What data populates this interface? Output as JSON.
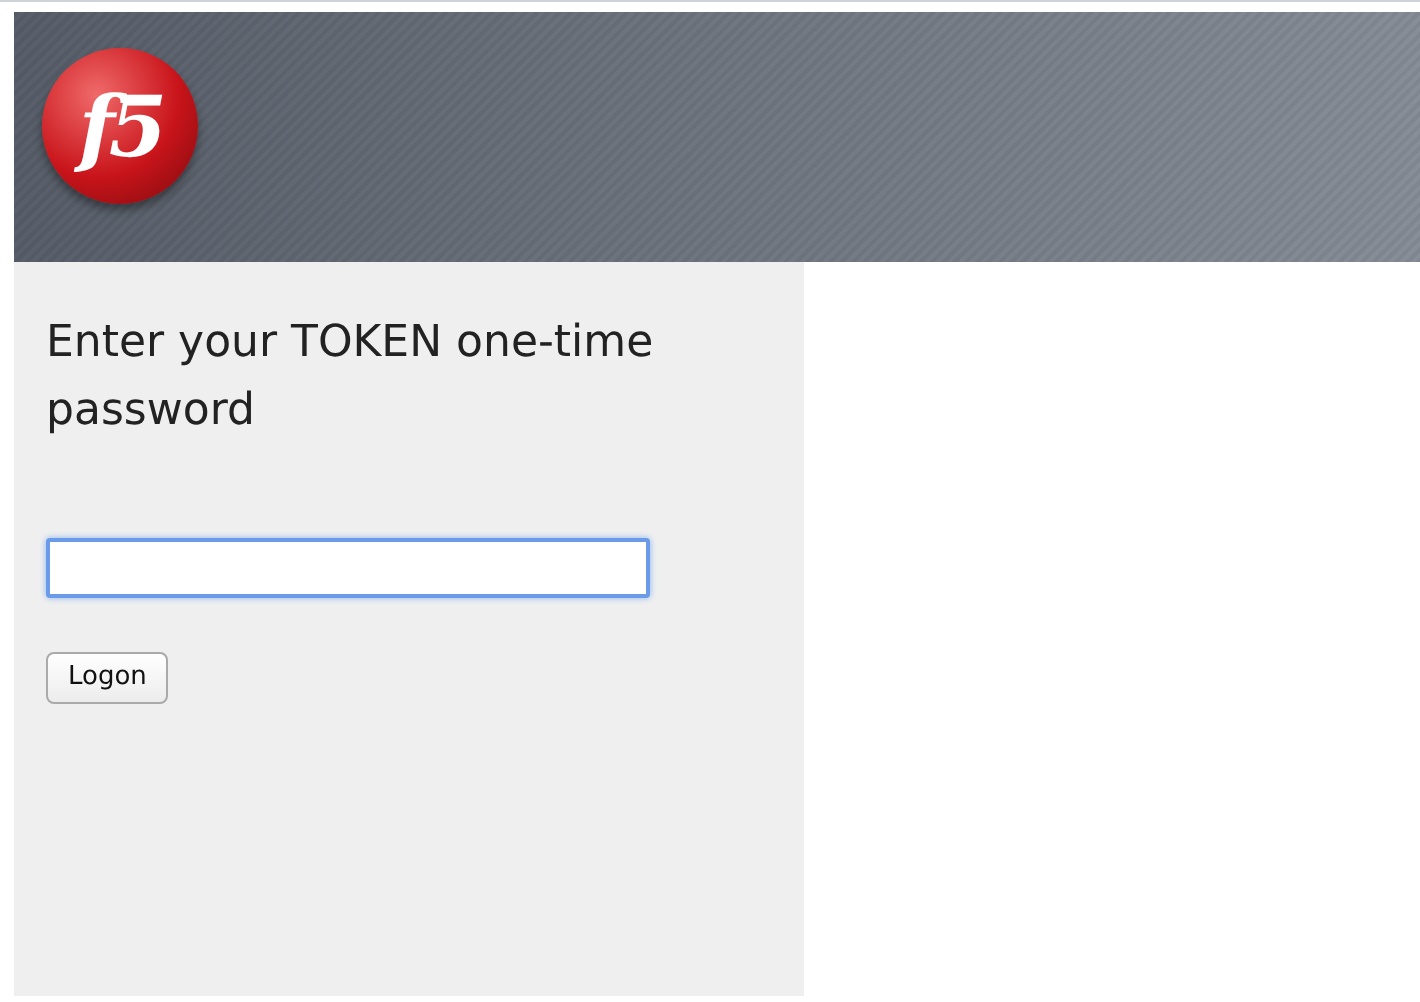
{
  "header": {
    "logo": "f5"
  },
  "login": {
    "prompt": "Enter your TOKEN one-time password",
    "field": {
      "focused": true
    },
    "button": "Logon"
  }
}
